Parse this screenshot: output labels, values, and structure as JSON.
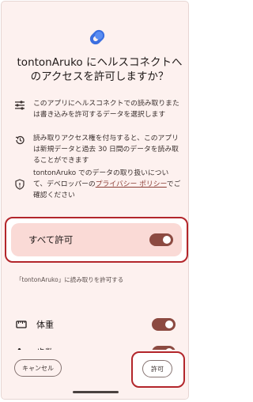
{
  "dialog": {
    "title": "tontonAruko にヘルスコネクトへのアクセスを許可しますか？",
    "info": [
      {
        "icon": "tune-sliders-icon",
        "text": "このアプリにヘルスコネクトでの読み取りまたは書き込みを許可するデータを選択します"
      },
      {
        "icon": "history-icon",
        "text": "読み取りアクセス権を付与すると、このアプリは新規データと過去 30 日間のデータを読み取ることができます"
      },
      {
        "icon": "shield-icon",
        "text_before": "tontonAruko でのデータの取り扱いについて、デベロッパーの",
        "link": "プライバシー ポリシー",
        "text_after": "でご確認ください"
      }
    ]
  },
  "allow_all": {
    "label": "すべて許可",
    "on": true
  },
  "read_section": {
    "label": "「tontonAruko」に読み取りを許可する",
    "items": [
      {
        "label": "体重",
        "icon": "scale-icon",
        "on": true
      },
      {
        "label": "歩数",
        "icon": "steps-icon",
        "on": true
      }
    ]
  },
  "buttons": {
    "cancel": "キャンセル",
    "allow": "許可"
  },
  "colors": {
    "accent": "#8c4a41",
    "highlight": "#b3262b",
    "card": "#fadad6"
  }
}
